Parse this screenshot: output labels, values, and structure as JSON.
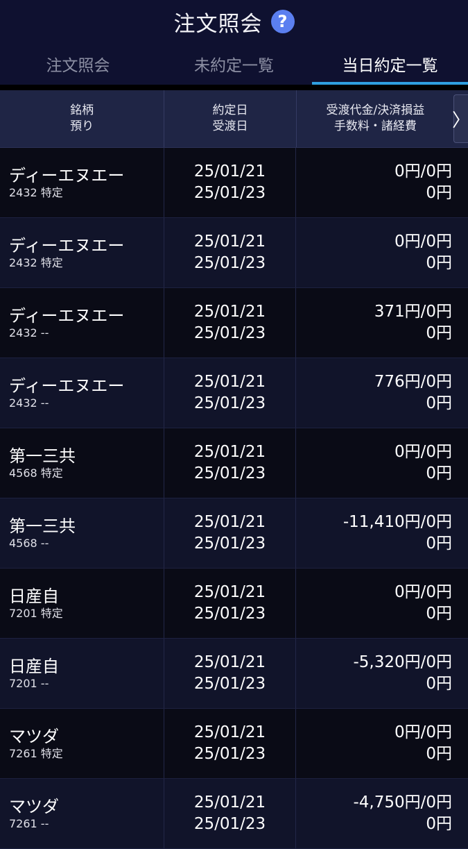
{
  "header": {
    "title": "注文照会",
    "help_symbol": "?"
  },
  "tabs": [
    {
      "label": "注文照会",
      "active": false
    },
    {
      "label": "未約定一覧",
      "active": false
    },
    {
      "label": "当日約定一覧",
      "active": true
    }
  ],
  "columns": {
    "col1_line1": "銘柄",
    "col1_line2": "預り",
    "col2_line1": "約定日",
    "col2_line2": "受渡日",
    "col3_line1": "受渡代金/決済損益",
    "col3_line2": "手数料・諸経費",
    "scroll_symbol": "〉"
  },
  "rows": [
    {
      "name": "ディーエヌエー",
      "code": "2432 特定",
      "trade_date": "25/01/21",
      "settle_date": "25/01/23",
      "amount": "0円/0円",
      "fee": "0円"
    },
    {
      "name": "ディーエヌエー",
      "code": "2432 特定",
      "trade_date": "25/01/21",
      "settle_date": "25/01/23",
      "amount": "0円/0円",
      "fee": "0円"
    },
    {
      "name": "ディーエヌエー",
      "code": "2432 --",
      "trade_date": "25/01/21",
      "settle_date": "25/01/23",
      "amount": "371円/0円",
      "fee": "0円"
    },
    {
      "name": "ディーエヌエー",
      "code": "2432 --",
      "trade_date": "25/01/21",
      "settle_date": "25/01/23",
      "amount": "776円/0円",
      "fee": "0円"
    },
    {
      "name": "第一三共",
      "code": "4568 特定",
      "trade_date": "25/01/21",
      "settle_date": "25/01/23",
      "amount": "0円/0円",
      "fee": "0円"
    },
    {
      "name": "第一三共",
      "code": "4568 --",
      "trade_date": "25/01/21",
      "settle_date": "25/01/23",
      "amount": "-11,410円/0円",
      "fee": "0円"
    },
    {
      "name": "日産自",
      "code": "7201 特定",
      "trade_date": "25/01/21",
      "settle_date": "25/01/23",
      "amount": "0円/0円",
      "fee": "0円"
    },
    {
      "name": "日産自",
      "code": "7201 --",
      "trade_date": "25/01/21",
      "settle_date": "25/01/23",
      "amount": "-5,320円/0円",
      "fee": "0円"
    },
    {
      "name": "マツダ",
      "code": "7261 特定",
      "trade_date": "25/01/21",
      "settle_date": "25/01/23",
      "amount": "0円/0円",
      "fee": "0円"
    },
    {
      "name": "マツダ",
      "code": "7261 --",
      "trade_date": "25/01/21",
      "settle_date": "25/01/23",
      "amount": "-4,750円/0円",
      "fee": "0円"
    }
  ]
}
